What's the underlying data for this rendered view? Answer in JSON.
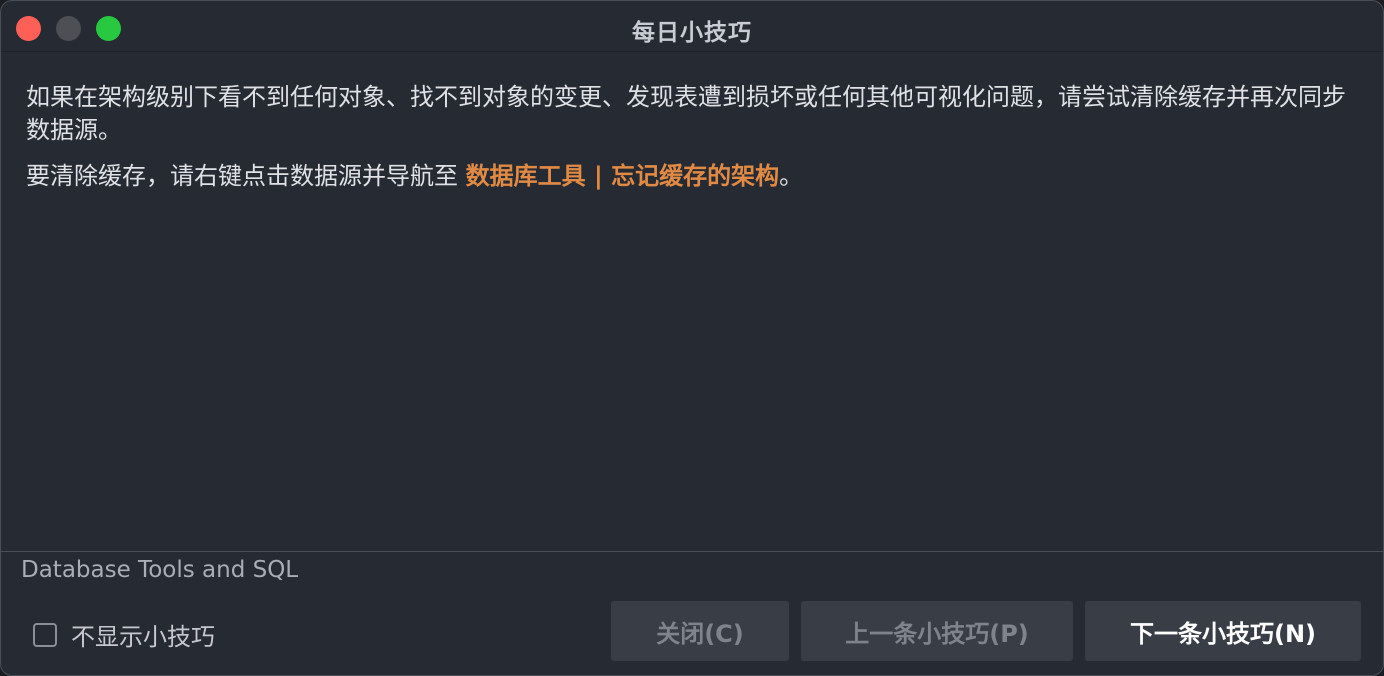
{
  "window": {
    "title": "每日小技巧"
  },
  "tip": {
    "paragraph1": "如果在架构级别下看不到任何对象、找不到对象的变更、发现表遭到损坏或任何其他可视化问题，请尝试清除缓存并再次同步数据源。",
    "paragraph2_prefix": "要清除缓存，请右键点击数据源并导航至 ",
    "paragraph2_action": "数据库工具 | 忘记缓存的架构",
    "paragraph2_suffix": "。"
  },
  "footer": {
    "category": "Database Tools and SQL",
    "checkbox_label": "不显示小技巧",
    "checkbox_checked": false,
    "buttons": {
      "close": "关闭(C)",
      "prev": "上一条小技巧(P)",
      "next": "下一条小技巧(N)"
    }
  },
  "colors": {
    "window_bg": "#262a33",
    "action_link": "#e08a44",
    "close_light": "#fe5f57",
    "minimize_light": "#4d4f55",
    "maximize_light": "#28c840",
    "button_bg": "#393d46"
  }
}
